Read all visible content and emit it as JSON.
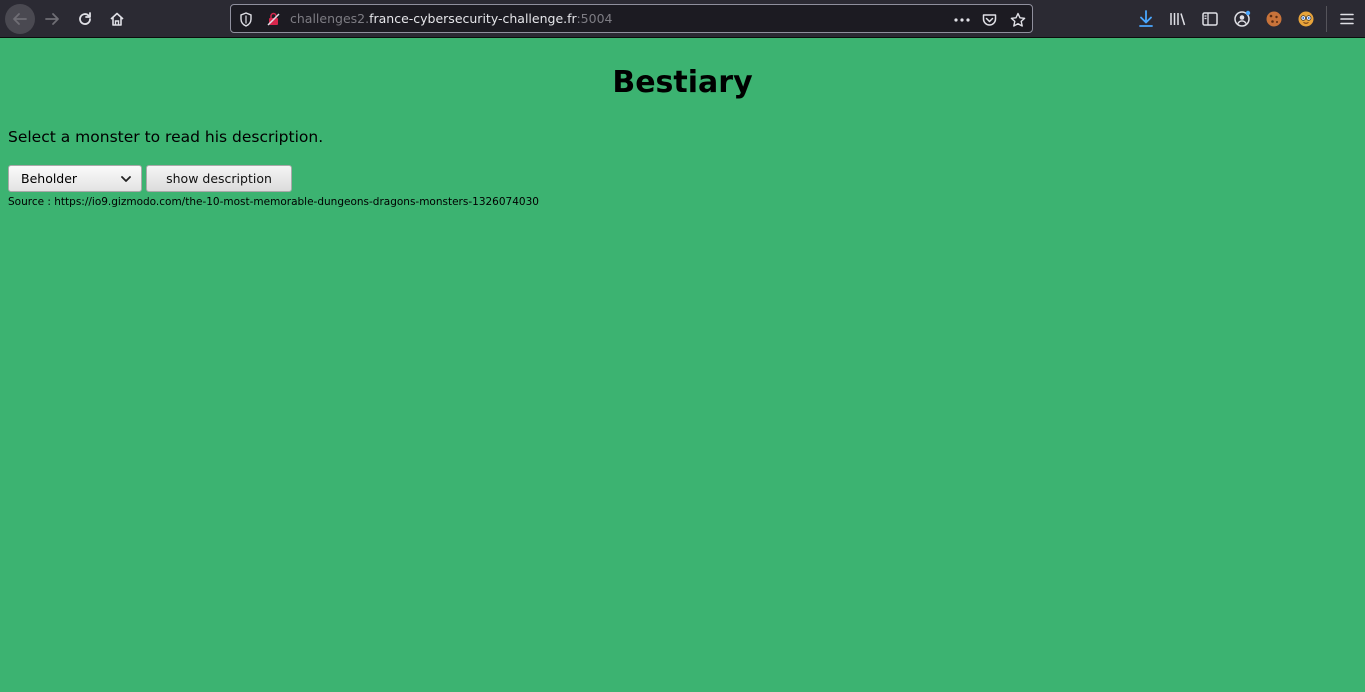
{
  "browser": {
    "url": {
      "subdomain": "challenges2.",
      "domain": "france-cybersecurity-challenge.fr",
      "port": ":5004"
    },
    "colors": {
      "toolbar_bg": "#2b2a33",
      "urlbar_bg": "#1c1b22",
      "download_accent": "#4aa7ff"
    },
    "nav_icons": [
      "back-arrow-icon",
      "forward-arrow-icon",
      "reload-icon",
      "home-icon"
    ],
    "urlbar_icons": [
      "tracking-protection-shield-icon",
      "insecure-connection-icon",
      "page-actions-icon",
      "pocket-icon",
      "bookmark-star-icon"
    ],
    "toolbar_icons": [
      "downloads-icon",
      "library-icon",
      "sidebar-icon",
      "account-icon",
      "cookie-extension-icon",
      "extension-face-icon",
      "hamburger-menu-icon"
    ]
  },
  "page": {
    "background": "#3cb371",
    "title": "Bestiary",
    "instruction": "Select a monster to read his description.",
    "monster_select": {
      "selected": "Beholder"
    },
    "show_button_label": "show description",
    "source_text": "Source : https://io9.gizmodo.com/the-10-most-memorable-dungeons-dragons-monsters-1326074030"
  }
}
